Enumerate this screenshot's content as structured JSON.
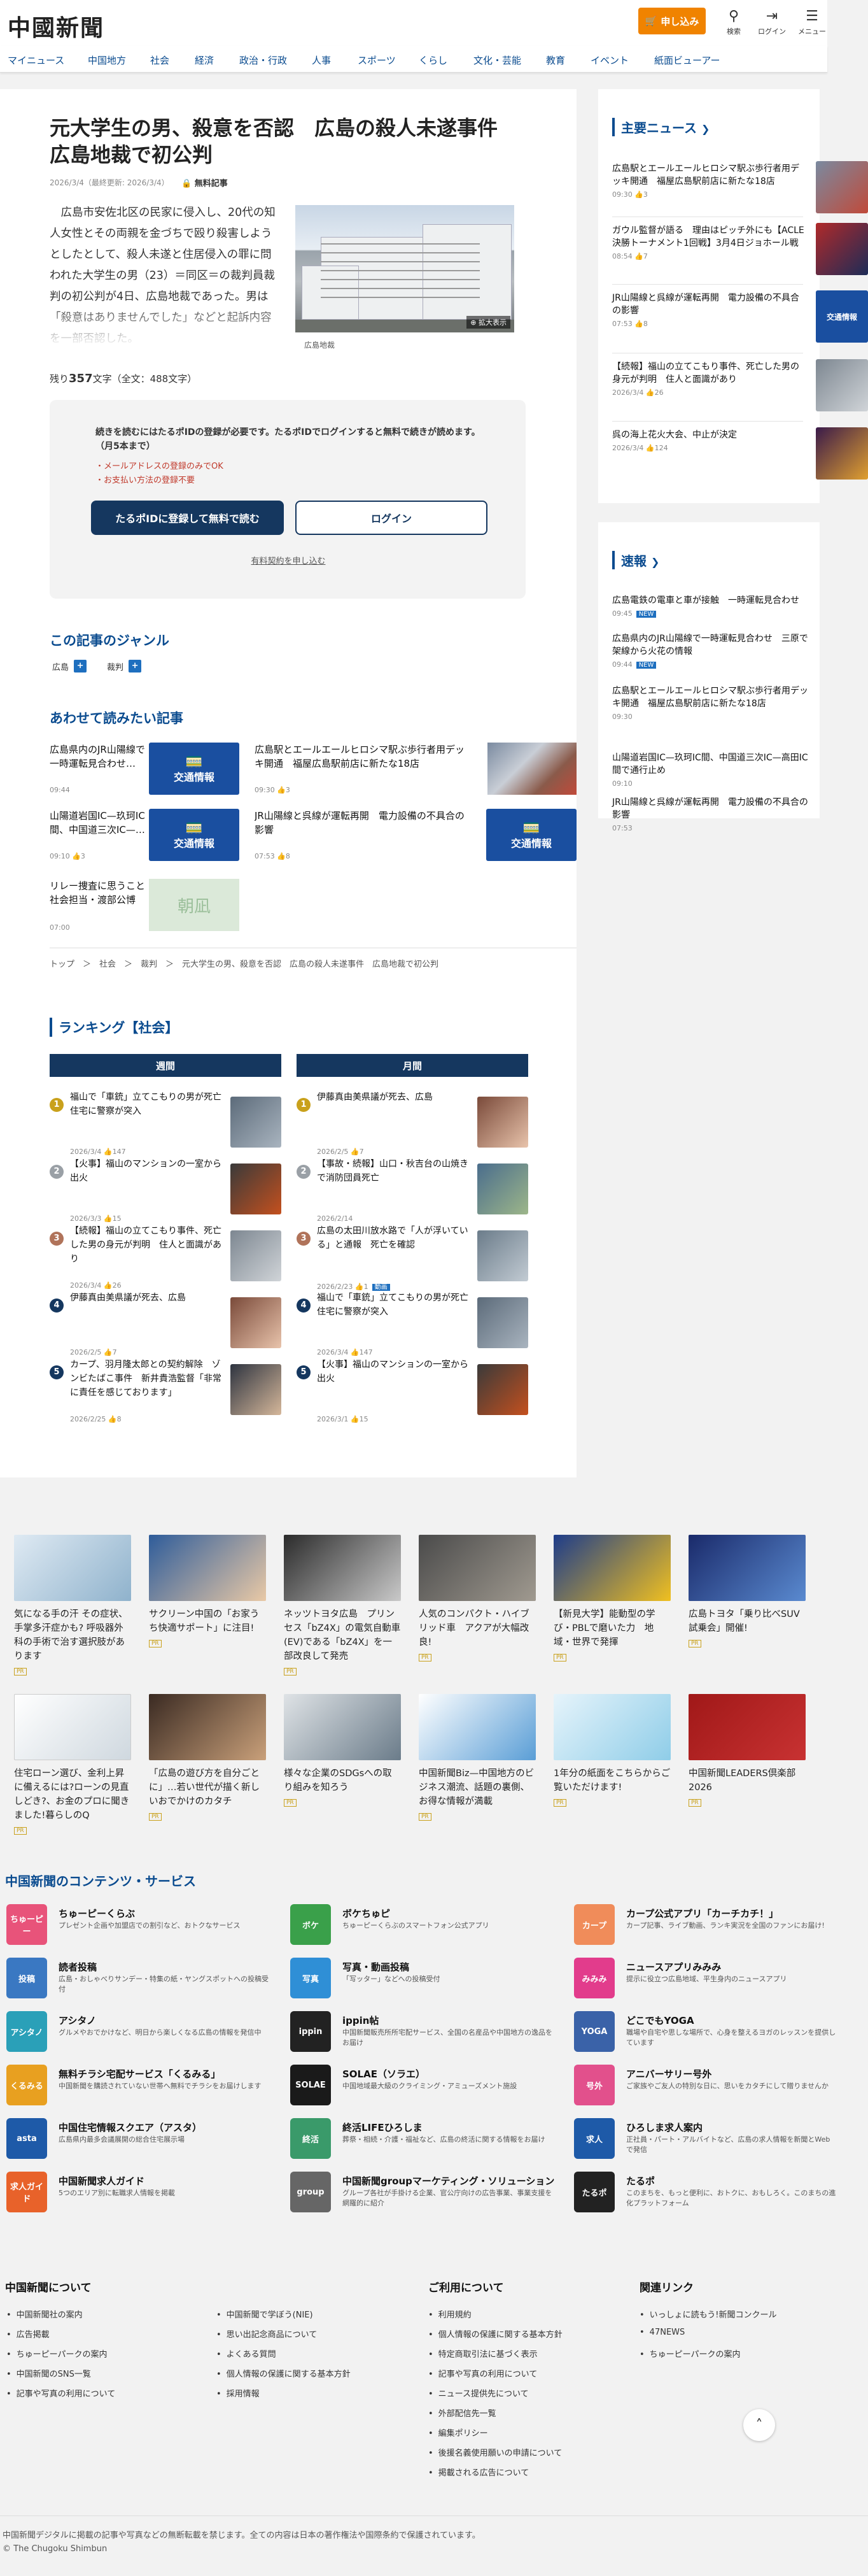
{
  "header": {
    "logo": "中國新聞",
    "apply_label": "申し込み",
    "icons": [
      {
        "name": "search-icon",
        "label": "検索"
      },
      {
        "name": "login-icon",
        "label": "ログイン"
      },
      {
        "name": "menu-icon",
        "label": "メニュー"
      }
    ],
    "accent": "#f08300"
  },
  "nav": [
    "マイニュース",
    "中国地方",
    "社会",
    "経済",
    "政治・行政",
    "人事",
    "スポーツ",
    "くらし",
    "文化・芸能",
    "教育",
    "イベント",
    "紙面ビューアー"
  ],
  "article": {
    "title": "元大学生の男、殺意を否認　広島の殺人未遂事件　広島地裁で初公判",
    "date": "2026/3/4（最終更新: 2026/3/4）",
    "member_badge": "無料記事",
    "lead": "　広島市安佐北区の民家に侵入し、20代の知人女性とその両親を金づちで殴り殺害しようとしたとして、殺人未遂と住居侵入の罪に問われた大学生の男（23）＝同区＝の裁判員裁判の初公判が4日、広島地裁であった。男は「殺意はありませんでした」などと起訴内容を一部否認した。",
    "photo_badge": "拡大表示",
    "photo_caption": "広島地裁",
    "remain_prefix": "残り",
    "remain_count": "357",
    "remain_suffix": "文字（全文：488文字）"
  },
  "paywall": {
    "message": "続きを読むにはたるポIDの登録が必要です。たるポIDでログインすると無料で続きが読めます。（月5本まで）",
    "notes": [
      "・メールアドレスの登録のみでOK",
      "・お支払い方法の登録不要"
    ],
    "register_label": "たるポIDに登録して無料で読む",
    "login_label": "ログイン",
    "paid_link": "有料契約を申し込む"
  },
  "genre": {
    "heading": "この記事のジャンル",
    "tags": [
      "広島",
      "裁判"
    ]
  },
  "related": {
    "heading": "あわせて読みたい記事",
    "traffic_label": "交通情報",
    "items": [
      {
        "title": "広島県内のJR山陽線で一時運転見合わせ…",
        "date": "09:44"
      },
      {
        "title": "広島駅とエールエールヒロシマ駅ぶ歩行者用デッキ開通　福屋広島駅前店に新たな18店",
        "date": "09:30",
        "count": "3"
      },
      {
        "title": "山陽道岩国IC—玖珂IC間、中国道三次IC—…",
        "date": "09:10",
        "count": "3"
      },
      {
        "title": "JR山陽線と呉線が運転再開　電力設備の不具合の影響",
        "date": "07:53",
        "count": "8"
      },
      {
        "title": "リレー捜査に思うこと　社会担当・渡部公博",
        "date": "07:00"
      }
    ],
    "banner_label": "朝凪"
  },
  "breadcrumb": "トップ　＞　社会　＞　裁判　＞　元大学生の男、殺意を否認　広島の殺人未遂事件　広島地裁で初公判",
  "ranking": {
    "heading": "ランキング【社会】",
    "weekly_label": "週間",
    "monthly_label": "月間",
    "weekly": [
      {
        "title": "福山で「車銃」立てこもりの男が死亡　住宅に警察が突入",
        "date": "2026/3/4",
        "count": "147"
      },
      {
        "title": "【火事】福山のマンションの一室から出火",
        "date": "2026/3/3",
        "count": "15"
      },
      {
        "title": "【続報】福山の立てこもり事件、死亡した男の身元が判明　住人と面識があり",
        "date": "2026/3/4",
        "count": "26"
      },
      {
        "title": "伊藤真由美県議が死去、広島",
        "date": "2026/2/5",
        "count": "7"
      },
      {
        "title": "カープ、羽月隆太郎との契約解除　ゾンビたばこ事件　新井貴浩監督「非常に責任を感じております」",
        "date": "2026/2/25",
        "count": "8"
      }
    ],
    "monthly": [
      {
        "title": "伊藤真由美県議が死去、広島",
        "date": "2026/2/5",
        "count": "7"
      },
      {
        "title": "【事故・続報】山口・秋吉台の山焼きで消防団員死亡",
        "date": "2026/2/14",
        "count": ""
      },
      {
        "title": "広島の太田川放水路で「人が浮いている」と通報　死亡を確認",
        "date": "2026/2/23",
        "count": "1",
        "tag": "動画"
      },
      {
        "title": "福山で「車銃」立てこもりの男が死亡　住宅に警察が突入",
        "date": "2026/3/4",
        "count": "147"
      },
      {
        "title": "【火事】福山のマンションの一室から出火",
        "date": "2026/3/1",
        "count": "15"
      }
    ]
  },
  "sidebar": {
    "main_heading": "主要ニュース",
    "main_news": [
      {
        "title": "広島駅とエールエールヒロシマ駅ぶ歩行者用デッキ開通　福屋広島駅前店に新たな18店",
        "date": "09:30",
        "count": "3"
      },
      {
        "title": "ガウル監督が語る　理由はピッチ外にも【ACLE決勝トーナメント1回戦】3月4日ジョホール戦",
        "date": "08:54",
        "count": "7"
      },
      {
        "title": "JR山陽線と呉線が運転再開　電力設備の不具合の影響",
        "date": "07:53",
        "count": "8"
      },
      {
        "title": "【続報】福山の立てこもり事件、死亡した男の身元が判明　住人と面識があり",
        "date": "2026/3/4",
        "count": "26"
      },
      {
        "title": "呉の海上花火大会、中止が決定",
        "date": "2026/3/4",
        "count": "124"
      }
    ],
    "flash_heading": "速報",
    "flash_news": [
      {
        "title": "広島電鉄の電車と車が接触　一時運転見合わせ",
        "date": "09:45",
        "tag": "NEW"
      },
      {
        "title": "広島県内のJR山陽線で一時運転見合わせ　三原で架線から火花の情報",
        "date": "09:44",
        "tag": "NEW"
      },
      {
        "title": "広島駅とエールエールヒロシマ駅ぶ歩行者用デッキ開通　福屋広島駅前店に新たな18店",
        "date": "09:30",
        "tag": ""
      },
      {
        "title": "山陽道岩国IC—玖珂IC間、中国道三次IC—高田IC間で通行止め",
        "date": "09:10",
        "tag": ""
      },
      {
        "title": "JR山陽線と呉線が運転再開　電力設備の不具合の影響",
        "date": "07:53",
        "tag": ""
      }
    ]
  },
  "ads": [
    {
      "text": "気になる手の汗 その症状、手掌多汗症かも? 呼吸器外科の手術で治す選択肢があります"
    },
    {
      "text": "サクリーン中国の「お家うち快適サポート」に注目!"
    },
    {
      "text": "ネッツトヨタ広島　プリンセス「bZ4X」の電気自動車(EV)である「bZ4X」を一部改良して発売"
    },
    {
      "text": "人気のコンパクト・ハイブリッド車　アクアが大幅改良!"
    },
    {
      "text": "【新見大学】能動型の学び・PBLで磨いた力　地域・世界で発揮"
    },
    {
      "text": "広島トヨタ「乗り比べSUV試乗会」開催!"
    },
    {
      "text": "住宅ローン選び、金利上昇に備えるには?ローンの見直しどき?、お金のプロに聞きました!暮らしのQ"
    },
    {
      "text": "「広島の遊び方を自分ごとに」…若い世代が描く新しいおでかけのカタチ"
    },
    {
      "text": "様々な企業のSDGsへの取り組みを知ろう"
    },
    {
      "text": "中国新聞Biz—中国地方のビジネス潮流、話題の裏側、お得な情報が満載"
    },
    {
      "text": "1年分の紙面をこちらからご覧いただけます!"
    },
    {
      "text": "中国新聞LEADERS倶楽部2026"
    }
  ],
  "ad_pr_label": "PR",
  "services": {
    "heading": "中国新聞のコンテンツ・サービス",
    "items": [
      {
        "name": "ちゅーピーくらぶ",
        "desc": "プレゼント企画や加盟店での割引など、おトクなサービス",
        "icon": "ちゅーピー"
      },
      {
        "name": "ボケちゅピ",
        "desc": "ちゅーピーくらぶのスマートフォン公式アプリ",
        "icon": "ボケ"
      },
      {
        "name": "カープ公式アプリ「カーチカチ！」",
        "desc": "カープ記事、ライブ動画、ランキ実況を全国のファンにお届け!",
        "icon": "カープ"
      },
      {
        "name": "読者投稿",
        "desc": "広島・おしゃべりサンデー・特集の紙・ヤングスポットへの投稿受付",
        "icon": "投稿"
      },
      {
        "name": "写真・動画投稿",
        "desc": "「写ッター」などへの投稿受付",
        "icon": "写真"
      },
      {
        "name": "ニュースアプリみみみ",
        "desc": "提示に役立つ広島地域、平生身内のニュースアプリ",
        "icon": "みみみ"
      },
      {
        "name": "アシタノ",
        "desc": "グルメやおでかけなど、明日から楽しくなる広島の情報を発信中",
        "icon": "アシタノ"
      },
      {
        "name": "ippin帖",
        "desc": "中国新聞販売所所宅配サービス、全国の名産品や中国地方の逸品をお届け",
        "icon": "ippin"
      },
      {
        "name": "どこでもYOGA",
        "desc": "職場や自宅や思しな場所で、心身を整えるヨガのレッスンを提供しています",
        "icon": "YOGA"
      },
      {
        "name": "無料チラシ宅配サービス「くるみる」",
        "desc": "中国新聞を購読されていない世帯へ無料でチラシをお届けします",
        "icon": "くるみる"
      },
      {
        "name": "SOLAE（ソラエ）",
        "desc": "中国地域最大級のクライミング・アミューズメント施設",
        "icon": "SOLAE"
      },
      {
        "name": "アニバーサリー号外",
        "desc": "ご家族やご友人の特別な日に、思いをカタチにして贈りませんか",
        "icon": "号外"
      },
      {
        "name": "中国住宅情報スクエア（アスタ）",
        "desc": "広島県内最多会議展開の総合住宅展示場",
        "icon": "asta"
      },
      {
        "name": "終活LIFEひろしま",
        "desc": "葬祭・相続・介護・福祉など、広島の終活に関する情報をお届け",
        "icon": "終活"
      },
      {
        "name": "ひろしま求人案内",
        "desc": "正社員・パート・アルバイトなど、広島の求人情報を新聞とWebで発信",
        "icon": "求人"
      },
      {
        "name": "中国新聞求人ガイド",
        "desc": "5つのエリア別に転職求人情報を掲載",
        "icon": "求人ガイド"
      },
      {
        "name": "中国新聞groupマーケティング・ソリューション",
        "desc": "グループ各社が手掛ける企業、官公庁向けの広告事業、事業支援を網羅的に紹介",
        "icon": "group"
      },
      {
        "name": "たるポ",
        "desc": "このまちを、もっと便利に、おトクに、おもしろく。このまちの進化プラットフォーム",
        "icon": "たるポ"
      }
    ]
  },
  "footer": {
    "about_heading": "中国新聞について",
    "about_col1": [
      "中国新聞社の案内",
      "広告掲載",
      "ちゅーピーパークの案内",
      "中国新聞のSNS一覧",
      "記事や写真の利用について"
    ],
    "about_col2": [
      "中国新聞で学ぼう(NIE)",
      "思い出記念商品について",
      "よくある質問",
      "個人情報の保護に関する基本方針",
      "採用情報"
    ],
    "guide_heading": "ご利用について",
    "guide_items": [
      "利用規約",
      "個人情報の保護に関する基本方針",
      "特定商取引法に基づく表示",
      "記事や写真の利用について",
      "ニュース提供先について",
      "外部配信先一覧",
      "編集ポリシー",
      "後援名義使用願いの申請について",
      "掲載される広告について"
    ],
    "links_heading": "関連リンク",
    "links_items": [
      "いっしょに読もう!新聞コンクール",
      "47NEWS",
      "ちゅーピーパークの案内"
    ],
    "notice": "中国新聞デジタルに掲載の記事や写真などの無断転載を禁じます。全ての内容は日本の著作権法や国際条約で保護されています。",
    "copyright": "© The Chugoku Shimbun"
  }
}
